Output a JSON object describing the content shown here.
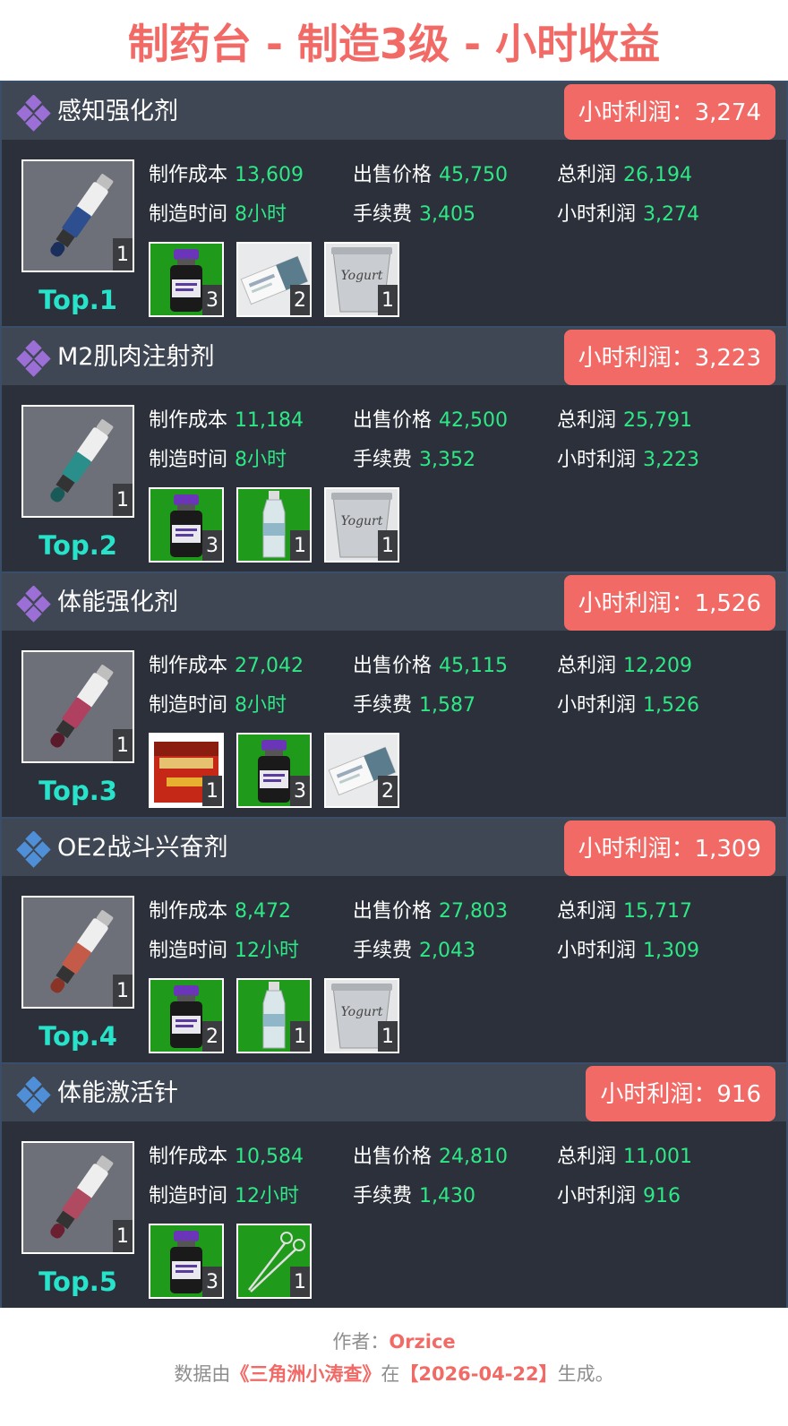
{
  "page": {
    "title": "制药台 - 制造3级 - 小时收益"
  },
  "labels": {
    "cost": "制作成本",
    "price": "出售价格",
    "total_profit": "总利润",
    "time": "制造时间",
    "fee": "手续费",
    "hourly_profit": "小时利润"
  },
  "colors": {
    "accent": "#f26a66",
    "value": "#2ee886",
    "rank": "#26e3c9",
    "card_bg": "#2b303b",
    "header_bg": "#404754",
    "tier_purple": "#9b6fd6",
    "tier_blue": "#4f8fd8"
  },
  "items": [
    {
      "name": "感知强化剂",
      "badge": "小时利润：3,274",
      "tier_icon": "purple-diamond-icon",
      "product_qty": "1",
      "rank": "Top.1",
      "cost": "13,609",
      "price": "45,750",
      "total_profit": "26,194",
      "time": "8小时",
      "fee": "3,405",
      "hourly_profit": "3,274",
      "materials": [
        {
          "icon": "vial-icon",
          "qty": "3"
        },
        {
          "icon": "packet-icon",
          "qty": "2"
        },
        {
          "icon": "yogurt-cup-icon",
          "qty": "1"
        }
      ]
    },
    {
      "name": "M2肌肉注射剂",
      "badge": "小时利润：3,223",
      "tier_icon": "purple-diamond-icon",
      "product_qty": "1",
      "rank": "Top.2",
      "cost": "11,184",
      "price": "42,500",
      "total_profit": "25,791",
      "time": "8小时",
      "fee": "3,352",
      "hourly_profit": "3,223",
      "materials": [
        {
          "icon": "vial-icon",
          "qty": "3"
        },
        {
          "icon": "water-bottle-icon",
          "qty": "1"
        },
        {
          "icon": "yogurt-cup-icon",
          "qty": "1"
        }
      ]
    },
    {
      "name": "体能强化剂",
      "badge": "小时利润：1,526",
      "tier_icon": "purple-diamond-icon",
      "product_qty": "1",
      "rank": "Top.3",
      "cost": "27,042",
      "price": "45,115",
      "total_profit": "12,209",
      "time": "8小时",
      "fee": "1,587",
      "hourly_profit": "1,526",
      "materials": [
        {
          "icon": "tea-tin-icon",
          "qty": "1"
        },
        {
          "icon": "vial-icon",
          "qty": "3"
        },
        {
          "icon": "packet-icon",
          "qty": "2"
        }
      ]
    },
    {
      "name": "OE2战斗兴奋剂",
      "badge": "小时利润：1,309",
      "tier_icon": "blue-diamond-icon",
      "product_qty": "1",
      "rank": "Top.4",
      "cost": "8,472",
      "price": "27,803",
      "total_profit": "15,717",
      "time": "12小时",
      "fee": "2,043",
      "hourly_profit": "1,309",
      "materials": [
        {
          "icon": "vial-icon",
          "qty": "2"
        },
        {
          "icon": "water-bottle-icon",
          "qty": "1"
        },
        {
          "icon": "yogurt-cup-icon",
          "qty": "1"
        }
      ]
    },
    {
      "name": "体能激活针",
      "badge": "小时利润：916",
      "tier_icon": "blue-diamond-icon",
      "product_qty": "1",
      "rank": "Top.5",
      "cost": "10,584",
      "price": "24,810",
      "total_profit": "11,001",
      "time": "12小时",
      "fee": "1,430",
      "hourly_profit": "916",
      "materials": [
        {
          "icon": "vial-icon",
          "qty": "3"
        },
        {
          "icon": "forceps-icon",
          "qty": "1"
        }
      ]
    }
  ],
  "footer": {
    "author_label": "作者：",
    "author": "Orzice",
    "source_prefix": "数据由",
    "source_name": "《三角洲小涛查》",
    "source_mid": "在",
    "source_date": "【2026-04-22】",
    "source_suffix": "生成。"
  }
}
